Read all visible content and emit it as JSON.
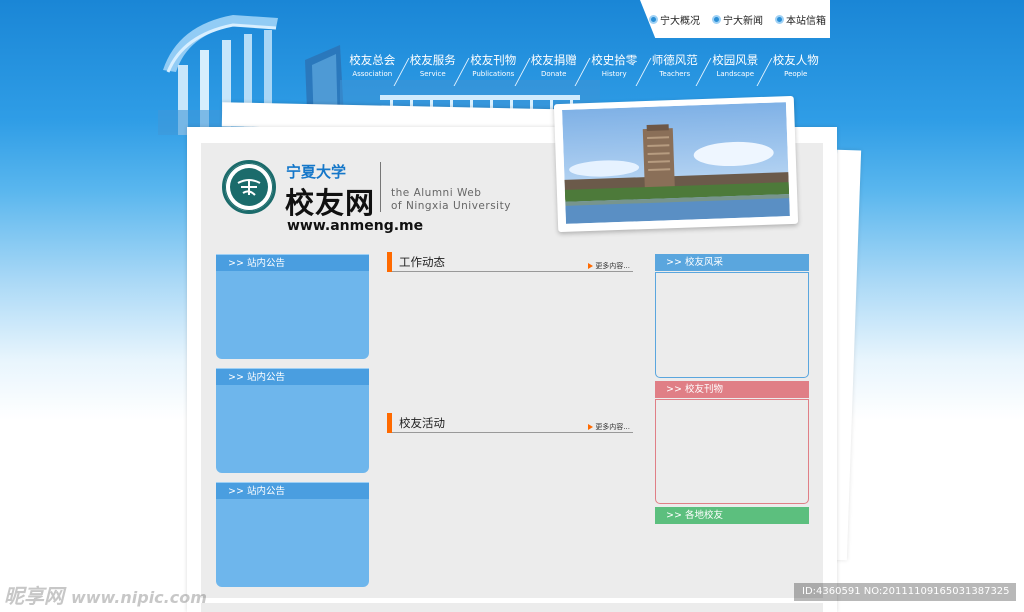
{
  "top_links": [
    {
      "label": "宁大概况"
    },
    {
      "label": "宁大新闻"
    },
    {
      "label": "本站信箱"
    }
  ],
  "nav": [
    {
      "cn": "校友总会",
      "en": "Association"
    },
    {
      "cn": "校友服务",
      "en": "Service"
    },
    {
      "cn": "校友刊物",
      "en": "Publications"
    },
    {
      "cn": "校友捐赠",
      "en": "Donate"
    },
    {
      "cn": "校史拾零",
      "en": "History"
    },
    {
      "cn": "师德风范",
      "en": "Teachers"
    },
    {
      "cn": "校园风景",
      "en": "Landscape"
    },
    {
      "cn": "校友人物",
      "en": "People"
    }
  ],
  "logo": {
    "university": "宁夏大学",
    "site_name": "校友网",
    "english_line1": "the Alumni Web",
    "english_line2": "of Ningxia University",
    "domain": "www.anmeng.me"
  },
  "left_panels": [
    {
      "title": ">>  站内公告"
    },
    {
      "title": ">>  站内公告"
    },
    {
      "title": ">>  站内公告"
    }
  ],
  "middle_sections": [
    {
      "title": "工作动态",
      "more": "更多内容..."
    },
    {
      "title": "校友活动",
      "more": "更多内容..."
    }
  ],
  "right_panels": [
    {
      "title": ">>  校友风采",
      "color": "#5aa6de",
      "border": "#5aa6de"
    },
    {
      "title": ">>  校友刊物",
      "color": "#e07f86",
      "border": "#e07f86"
    },
    {
      "title": ">>  各地校友",
      "color": "#5cbf7e",
      "border": "#5cbf7e"
    }
  ],
  "watermark": {
    "left_cn": "昵享网",
    "left_en": "www.nipic.com",
    "right": "ID:4360591 NO:20111109165031387325"
  }
}
